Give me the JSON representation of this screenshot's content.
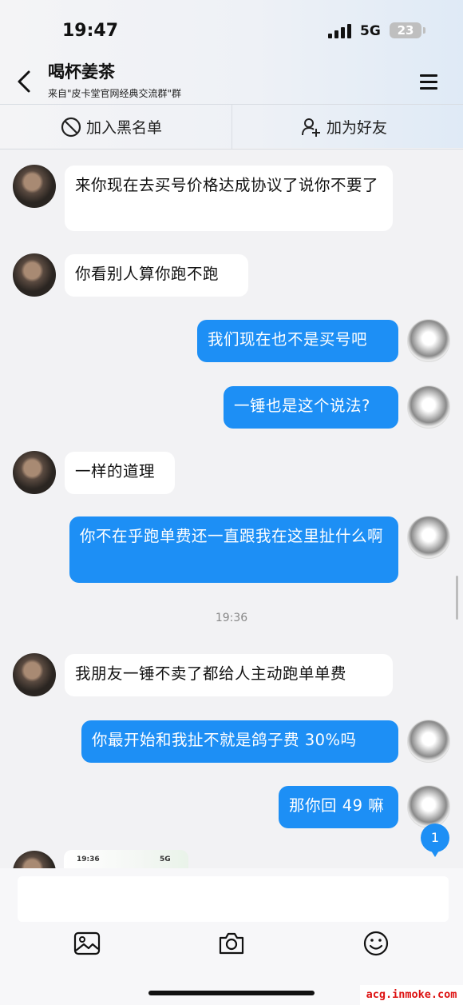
{
  "status_bar": {
    "time": "19:47",
    "network": "5G",
    "battery": "23"
  },
  "header": {
    "title": "喝杯姜茶",
    "subtitle": "来自\"皮卡堂官网经典交流群\"群",
    "blacklist_label": "加入黑名单",
    "add_friend_label": "加为好友"
  },
  "messages": [
    {
      "side": "left",
      "text": "来你现在去买号价格达成协议了说你不要了"
    },
    {
      "side": "left",
      "text": "你看别人算你跑不跑"
    },
    {
      "side": "right",
      "text": "我们现在也不是买号吧"
    },
    {
      "side": "right",
      "text": "一锤也是这个说法?"
    },
    {
      "side": "left",
      "text": "一样的道理"
    },
    {
      "side": "right",
      "text": "你不在乎跑单费还一直跟我在这里扯什么啊"
    },
    {
      "side": "left",
      "text": "我朋友一锤不卖了都给人主动跑单单费"
    },
    {
      "side": "right",
      "text": "你最开始和我扯不就是鸽子费 30%吗"
    },
    {
      "side": "right",
      "text": "那你回 49 嘛"
    }
  ],
  "timestamp": "19:36",
  "image_preview": {
    "time": "19:36",
    "network": "5G"
  },
  "unread_badge": "1",
  "input": {
    "placeholder": ""
  },
  "toolbar": {
    "icons": [
      "image-icon",
      "camera-icon",
      "emoji-icon"
    ]
  },
  "watermark": "acg.inmoke.com"
}
